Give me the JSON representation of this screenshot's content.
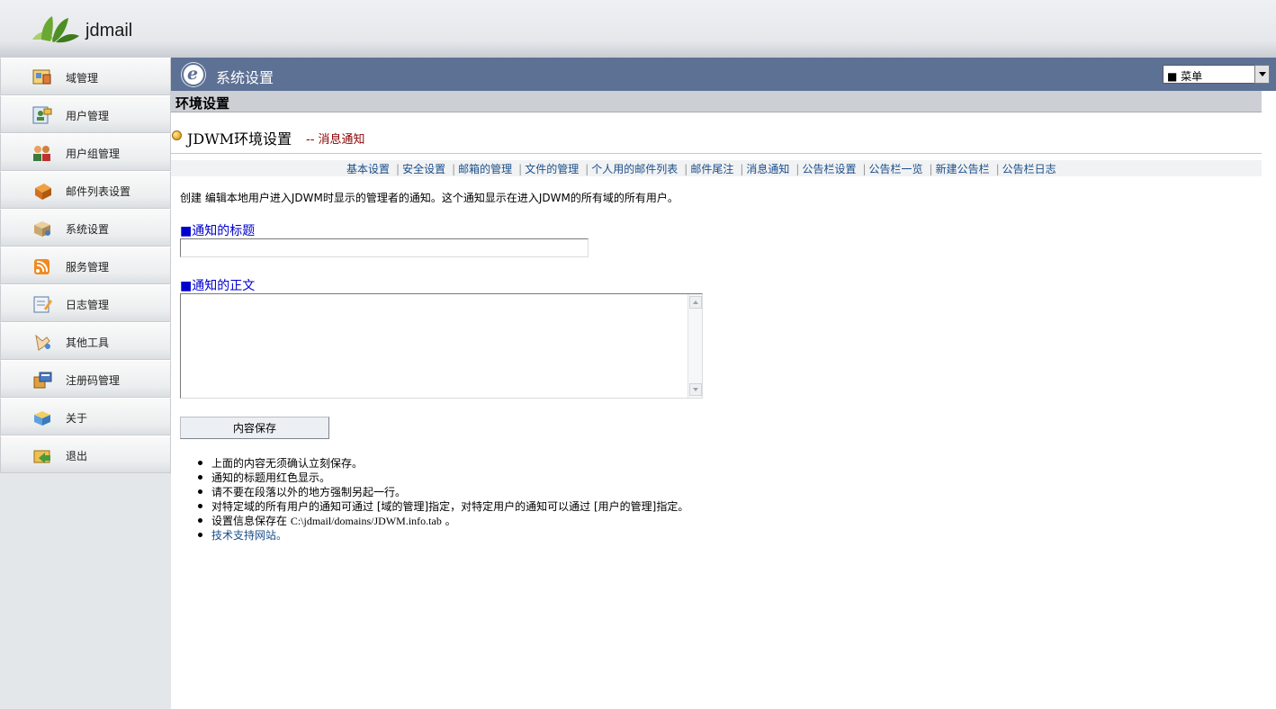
{
  "header": {
    "brand": "jdmail"
  },
  "sidebar": {
    "items": [
      {
        "label": "域管理",
        "icon": "domain-icon"
      },
      {
        "label": "用户管理",
        "icon": "user-icon"
      },
      {
        "label": "用户组管理",
        "icon": "user-group-icon"
      },
      {
        "label": "邮件列表设置",
        "icon": "mailing-list-icon"
      },
      {
        "label": "系统设置",
        "icon": "system-settings-icon"
      },
      {
        "label": "服务管理",
        "icon": "service-icon"
      },
      {
        "label": "日志管理",
        "icon": "log-icon"
      },
      {
        "label": "其他工具",
        "icon": "tools-icon"
      },
      {
        "label": "注册码管理",
        "icon": "license-icon"
      },
      {
        "label": "关于",
        "icon": "about-icon"
      },
      {
        "label": "退出",
        "icon": "logout-icon"
      }
    ]
  },
  "titlebar": {
    "title": "系统设置",
    "menu_value": "■ 菜单"
  },
  "section": {
    "title": "环境设置"
  },
  "subtitle": {
    "title": "JDWM环境设置",
    "tag": "-- 消息通知"
  },
  "tabs": [
    "基本设置",
    "安全设置",
    "邮箱的管理",
    "文件的管理",
    "个人用的邮件列表",
    "邮件尾注",
    "消息通知",
    "公告栏设置",
    "公告栏一览",
    "新建公告栏",
    "公告栏日志"
  ],
  "form": {
    "description": "创建 编辑本地用户进入JDWM时显示的管理者的通知。这个通知显示在进入JDWM的所有域的所有用户。",
    "title_label": "■通知的标题",
    "title_value": "",
    "body_label": "■通知的正文",
    "body_value": "",
    "save_label": "内容保存"
  },
  "notes": {
    "n1": "上面的内容无须确认立刻保存。",
    "n2": "通知的标题用红色显示。",
    "n3": "请不要在段落以外的地方强制另起一行。",
    "n4": "对特定域的所有用户的通知可通过 [域的管理]指定，对特定用户的通知可以通过 [用户的管理]指定。",
    "n5_prefix": "设置信息保存在 ",
    "n5_path": "C:\\jdmail/domains/JDWM.info.tab",
    "n5_suffix": " 。",
    "n6": "技术支持网站。"
  },
  "colors": {
    "titlebar": "#5d7195",
    "link": "#1a4f8a",
    "label": "#0000cc",
    "tag": "#8b0000"
  }
}
